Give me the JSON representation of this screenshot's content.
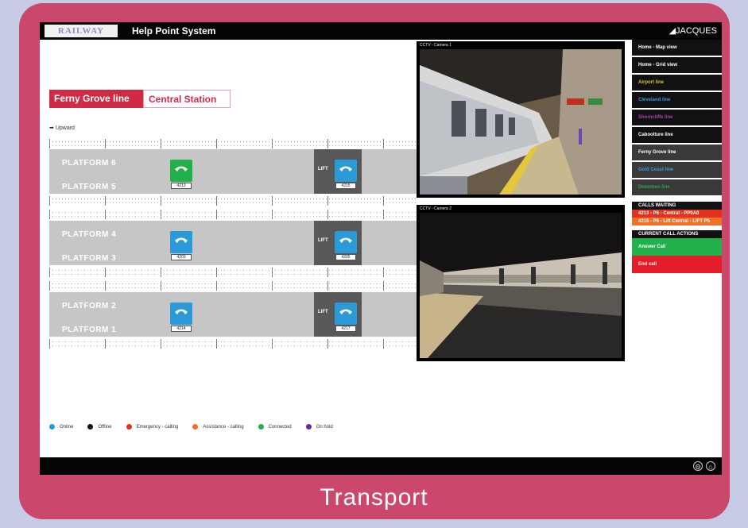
{
  "header": {
    "logo": "RAILWAY",
    "title": "Help Point System",
    "brand": "JACQUES"
  },
  "tabs": [
    {
      "label": "Ferny Grove line"
    },
    {
      "label": "Central Station"
    }
  ],
  "direction_label": "Upward",
  "platforms": [
    {
      "top": "PLATFORM 6",
      "bottom": "PLATFORM 5",
      "phone_code": "4213",
      "lift_code": "4215",
      "lift_label": "LIFT"
    },
    {
      "top": "PLATFORM 4",
      "bottom": "PLATFORM 3",
      "phone_code": "4203",
      "lift_code": "4205",
      "lift_label": "LIFT"
    },
    {
      "top": "PLATFORM 2",
      "bottom": "PLATFORM 1",
      "phone_code": "4214",
      "lift_code": "4217",
      "lift_label": "LIFT"
    }
  ],
  "cameras": [
    {
      "label": "CCTV - Camera 1"
    },
    {
      "label": "CCTV - Camera 2"
    }
  ],
  "sidebar": {
    "items": [
      {
        "label": "Home - Map view",
        "bg": "#111111",
        "fg": "#ffffff"
      },
      {
        "label": "Home - Grid view",
        "bg": "#111111",
        "fg": "#ffffff"
      },
      {
        "label": "Airport line",
        "bg": "#111111",
        "fg": "#e0c030"
      },
      {
        "label": "Cleveland line",
        "bg": "#111111",
        "fg": "#3a9ad8"
      },
      {
        "label": "Shorncliffe line",
        "bg": "#111111",
        "fg": "#b040b0"
      },
      {
        "label": "Caboolture line",
        "bg": "#111111",
        "fg": "#ffffff"
      },
      {
        "label": "Ferny Grove line",
        "bg": "#3a3a3a",
        "fg": "#ffffff"
      },
      {
        "label": "Gold Coast line",
        "bg": "#3a3a3a",
        "fg": "#3a9ad8"
      },
      {
        "label": "Doomben line",
        "bg": "#3a3a3a",
        "fg": "#30a050"
      }
    ],
    "calls_waiting_title": "CALLS WAITING",
    "calls_waiting": [
      {
        "label": "4213 - P6 - Central - PP0A0",
        "bg": "#e0321e"
      },
      {
        "label": "4215 - P6 - Lift Central - LIFT P5",
        "bg": "#f07028"
      }
    ],
    "current_call_title": "CURRENT CALL ACTIONS",
    "actions": [
      {
        "label": "Answer Call",
        "bg": "#21b04b"
      },
      {
        "label": "End call",
        "bg": "#e31e2a"
      }
    ]
  },
  "legend": [
    {
      "label": "Online",
      "color": "#2a9ad8"
    },
    {
      "label": "Offline",
      "color": "#111111"
    },
    {
      "label": "Emergency - calling",
      "color": "#e0321e"
    },
    {
      "label": "Assistance - calling",
      "color": "#f07028"
    },
    {
      "label": "Connected",
      "color": "#21b04b"
    },
    {
      "label": "On hold",
      "color": "#6a2aa8"
    }
  ],
  "phone_colors": {
    "online": "#2a9ad8",
    "connected": "#21b04b"
  },
  "caption": "Transport"
}
